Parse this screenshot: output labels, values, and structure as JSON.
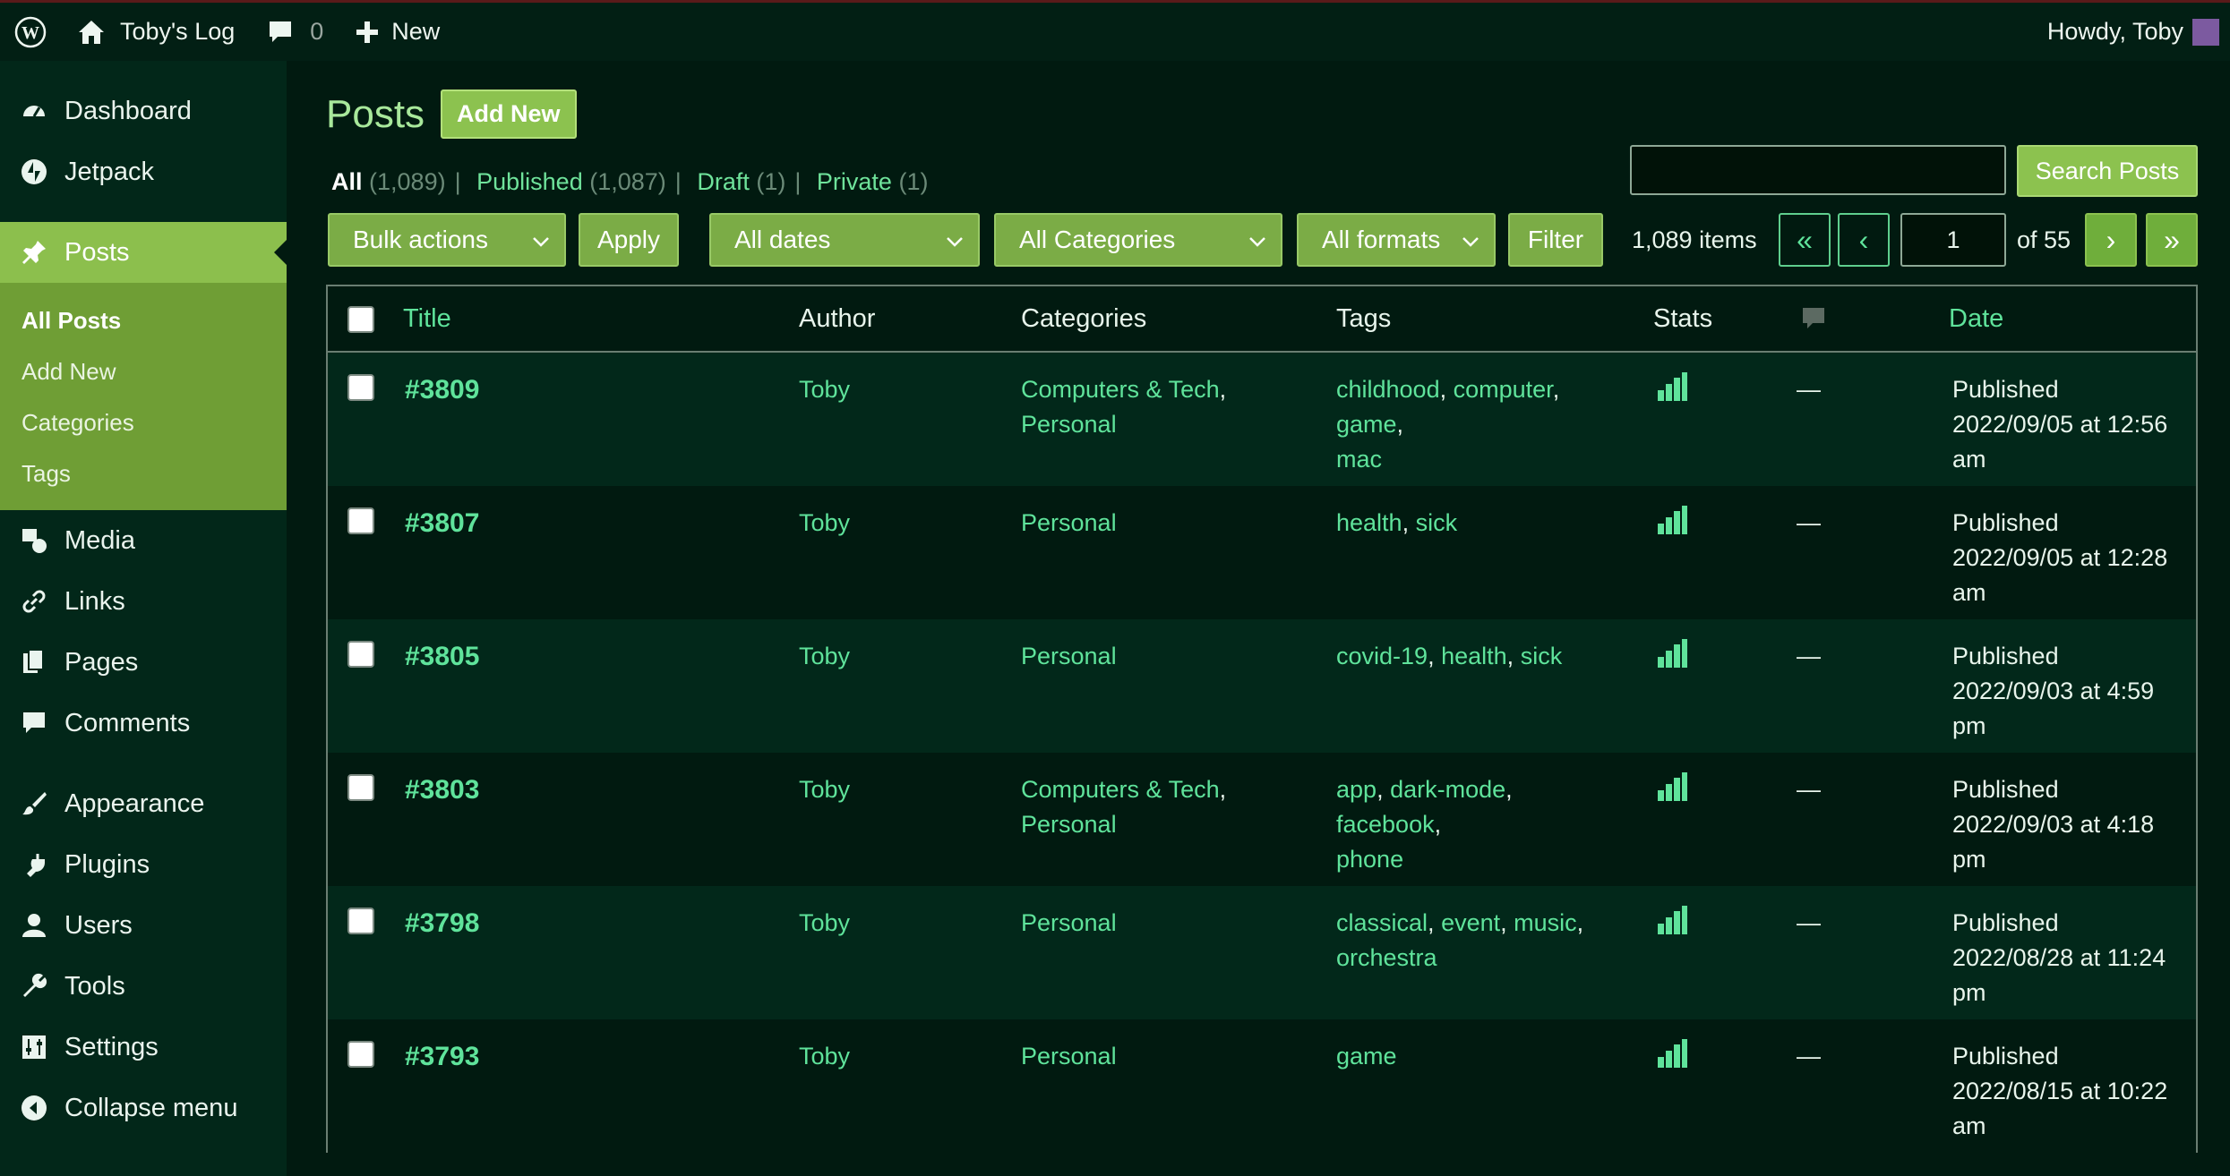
{
  "adminbar": {
    "site_name": "Toby's Log",
    "comments_count": "0",
    "new_label": "New",
    "howdy": "Howdy, Toby"
  },
  "sidebar": {
    "items": [
      {
        "label": "Dashboard",
        "icon": "dashboard-icon"
      },
      {
        "label": "Jetpack",
        "icon": "jetpack-icon"
      },
      {
        "label": "Posts",
        "icon": "pin-icon"
      },
      {
        "label": "Media",
        "icon": "media-icon"
      },
      {
        "label": "Links",
        "icon": "link-icon"
      },
      {
        "label": "Pages",
        "icon": "pages-icon"
      },
      {
        "label": "Comments",
        "icon": "comment-icon"
      },
      {
        "label": "Appearance",
        "icon": "brush-icon"
      },
      {
        "label": "Plugins",
        "icon": "plug-icon"
      },
      {
        "label": "Users",
        "icon": "user-icon"
      },
      {
        "label": "Tools",
        "icon": "wrench-icon"
      },
      {
        "label": "Settings",
        "icon": "sliders-icon"
      },
      {
        "label": "Collapse menu",
        "icon": "collapse-icon"
      }
    ],
    "submenu": [
      "All Posts",
      "Add New",
      "Categories",
      "Tags"
    ]
  },
  "main": {
    "page_title": "Posts",
    "add_new": "Add New",
    "status": [
      {
        "label": "All",
        "count": "(1,089)"
      },
      {
        "label": "Published",
        "count": "(1,087)"
      },
      {
        "label": "Draft",
        "count": "(1)"
      },
      {
        "label": "Private",
        "count": "(1)"
      }
    ],
    "search_button": "Search Posts",
    "bulk_actions": "Bulk actions",
    "apply": "Apply",
    "all_dates": "All dates",
    "all_categories": "All Categories",
    "all_formats": "All formats",
    "filter": "Filter",
    "items_count": "1,089 items",
    "pagination": {
      "first": "«",
      "prev": "‹",
      "current_page": "1",
      "of_label": "of 55",
      "next": "›",
      "last": "»"
    },
    "columns": {
      "title": "Title",
      "author": "Author",
      "categories": "Categories",
      "tags": "Tags",
      "stats": "Stats",
      "date": "Date"
    },
    "rows": [
      {
        "title": "#3809",
        "author": "Toby",
        "categories": [
          "Computers & Tech",
          "Personal"
        ],
        "tags": [
          "childhood",
          "computer",
          "game",
          "mac"
        ],
        "comments": "—",
        "date": [
          "Published",
          "2022/09/05 at 12:56",
          "am"
        ]
      },
      {
        "title": "#3807",
        "author": "Toby",
        "categories": [
          "Personal"
        ],
        "tags": [
          "health",
          "sick"
        ],
        "comments": "—",
        "date": [
          "Published",
          "2022/09/05 at 12:28",
          "am"
        ]
      },
      {
        "title": "#3805",
        "author": "Toby",
        "categories": [
          "Personal"
        ],
        "tags": [
          "covid-19",
          "health",
          "sick"
        ],
        "comments": "—",
        "date": [
          "Published",
          "2022/09/03 at 4:59",
          "pm"
        ]
      },
      {
        "title": "#3803",
        "author": "Toby",
        "categories": [
          "Computers & Tech",
          "Personal"
        ],
        "tags": [
          "app",
          "dark-mode",
          "facebook",
          "phone"
        ],
        "comments": "—",
        "date": [
          "Published",
          "2022/09/03 at 4:18",
          "pm"
        ]
      },
      {
        "title": "#3798",
        "author": "Toby",
        "categories": [
          "Personal"
        ],
        "tags": [
          "classical",
          "event",
          "music",
          "orchestra"
        ],
        "comments": "—",
        "date": [
          "Published",
          "2022/08/28 at 11:24",
          "pm"
        ]
      },
      {
        "title": "#3793",
        "author": "Toby",
        "categories": [
          "Personal"
        ],
        "tags": [
          "game"
        ],
        "comments": "—",
        "date": [
          "Published",
          "2022/08/15 at 10:22",
          "am"
        ]
      }
    ]
  }
}
